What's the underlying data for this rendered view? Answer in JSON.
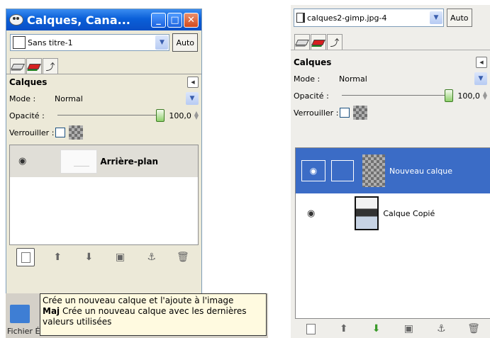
{
  "left": {
    "window_title": "Calques, Cana...",
    "window_buttons": {
      "minimize": "_",
      "maximize": "□",
      "close": "✕"
    },
    "image_combo": "Sans titre-1",
    "auto_label": "Auto",
    "dock_title": "Calques",
    "mode_label": "Mode :",
    "mode_value": "Normal",
    "opacity_label": "Opacité :",
    "opacity_value": "100,0",
    "opacity_percent": 100,
    "lock_label": "Verrouiller :",
    "layers": [
      {
        "name": "Arrière-plan",
        "visible": true
      }
    ],
    "bottom_buttons": [
      "new-layer-icon",
      "raise-icon",
      "lower-icon",
      "duplicate-icon",
      "anchor-icon",
      "delete-icon"
    ]
  },
  "tooltip": {
    "line1": "Crée un nouveau calque et l'ajoute à l'image",
    "line2_key": "Maj",
    "line2_text": "Crée un nouveau calque avec les dernières",
    "line3": "valeurs utilisées"
  },
  "behind_menu": "Fichier   Édition   Sélection   Affichage   Image   C",
  "right": {
    "image_combo": "calques2-gimp.jpg-4",
    "auto_label": "Auto",
    "dock_title": "Calques",
    "mode_label": "Mode :",
    "mode_value": "Normal",
    "opacity_label": "Opacité :",
    "opacity_value": "100,0",
    "opacity_percent": 100,
    "lock_label": "Verrouiller :",
    "layers": [
      {
        "name": "Nouveau calque",
        "selected": true
      },
      {
        "name": "Calque Copié",
        "selected": false
      }
    ]
  },
  "colors": {
    "titlebar": "#0a5fd8",
    "selection": "#3b6cc6",
    "tooltip_bg": "#fffae0"
  }
}
